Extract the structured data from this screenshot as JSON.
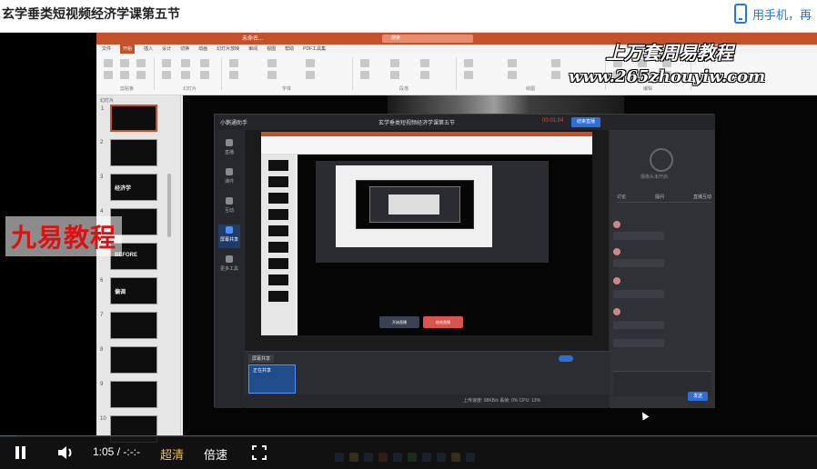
{
  "page": {
    "title": "玄学垂类短视频经济学课第五节",
    "phone_link": "用手机，再"
  },
  "ppt": {
    "window_title": "未命名...",
    "search_placeholder": "搜索",
    "tabs": [
      "文件",
      "开始",
      "插入",
      "设计",
      "切换",
      "动画",
      "幻灯片放映",
      "审阅",
      "视图",
      "帮助",
      "PDF工具集"
    ],
    "ribbon_groups": [
      "剪贴板",
      "幻灯片",
      "字体",
      "段落",
      "绘图",
      "编辑"
    ],
    "thumbs_header": "幻灯片",
    "thumbnails": [
      {
        "num": "1",
        "label": ""
      },
      {
        "num": "2",
        "label": ""
      },
      {
        "num": "3",
        "label": "经济学"
      },
      {
        "num": "4",
        "label": ""
      },
      {
        "num": "5",
        "label": "BEFORE"
      },
      {
        "num": "6",
        "label": "偏调"
      },
      {
        "num": "7",
        "label": ""
      },
      {
        "num": "8",
        "label": ""
      },
      {
        "num": "9",
        "label": ""
      },
      {
        "num": "10",
        "label": ""
      }
    ]
  },
  "share": {
    "app_name": "小鹅通助手",
    "meeting_title": "玄学垂类短视频经济学课第五节",
    "viewers": "32",
    "timer": "00:01:04",
    "end_button": "结束直播",
    "nav": [
      "直播",
      "课件",
      "互动",
      "屏幕共享",
      "更多工具"
    ],
    "right_tabs": [
      "讨论",
      "提问",
      "直播互动"
    ],
    "camera_hint": "摄像头未开启",
    "send": "发送",
    "bottom_tag": "屏幕共享",
    "bottom_card": "正在共享",
    "status": "上传速度: 98KB/s  丢帧: 0%  CPU: 13%",
    "nested_btn_left": "开始直播",
    "nested_btn_right": "结束直播"
  },
  "overlays": {
    "site_title": "上万套周易教程",
    "site_url": "www.265zhouyiw.com",
    "brand": "九易教程"
  },
  "player": {
    "time": "1:05 / -:-:-",
    "quality": "超清",
    "speed": "倍速",
    "progress": 0.02
  },
  "colors": {
    "ppt_accent": "#c4512c",
    "share_accent": "#2d6ed7",
    "quality_color": "#f0c24b",
    "brand_red": "#dd1111"
  }
}
